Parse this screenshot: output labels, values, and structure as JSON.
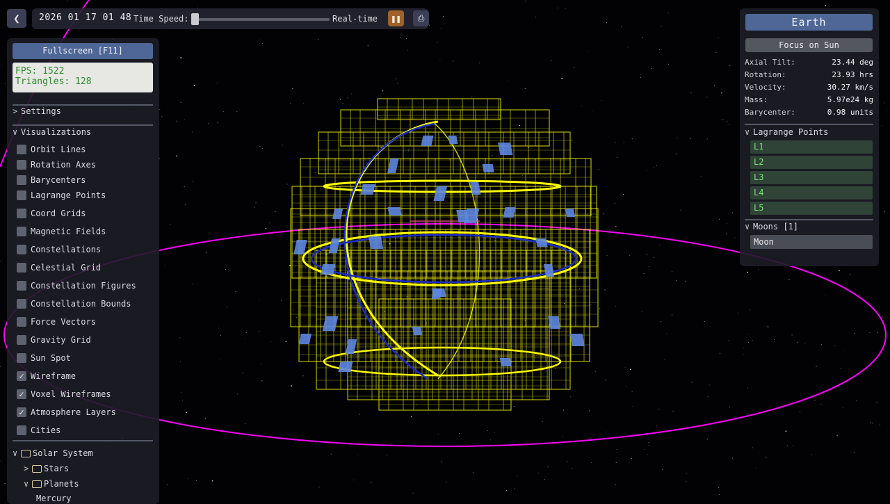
{
  "topbar": {
    "back_icon": "chevron-left-icon",
    "datetime": "2026 01 17 01 48",
    "time_speed_label": "Time Speed:",
    "time_speed_value": 0.0,
    "realtime_label": "Real-time",
    "pause_icon": "pause-icon",
    "pause_glyph": "❚❚",
    "screenshot_icon": "camera-icon",
    "screenshot_glyph": "⎙"
  },
  "left_panel": {
    "fullscreen_label": "Fullscreen [F11]",
    "fps_text": "FPS: 1522",
    "triangles_text": "Triangles: 128",
    "settings_label": "Settings",
    "visualizations_label": "Visualizations",
    "visualizations": [
      {
        "label": "Orbit Lines",
        "checked": false
      },
      {
        "label": "Rotation Axes",
        "checked": false
      },
      {
        "label": "Barycenters",
        "checked": false
      },
      {
        "label": "Lagrange Points",
        "checked": false
      },
      {
        "label": "Coord Grids",
        "checked": false
      },
      {
        "label": "Magnetic Fields",
        "checked": false
      },
      {
        "label": "Constellations",
        "checked": false
      },
      {
        "label": "Celestial Grid",
        "checked": false
      },
      {
        "label": "Constellation Figures",
        "checked": false
      },
      {
        "label": "Constellation Bounds",
        "checked": false
      },
      {
        "label": "Force Vectors",
        "checked": false
      },
      {
        "label": "Gravity Grid",
        "checked": false
      },
      {
        "label": "Sun Spot",
        "checked": false
      },
      {
        "label": "Wireframe",
        "checked": true
      },
      {
        "label": "Voxel Wireframes",
        "checked": true
      },
      {
        "label": "Atmosphere Layers",
        "checked": true
      },
      {
        "label": "Cities",
        "checked": false
      }
    ],
    "tree": {
      "solar_system": "Solar System",
      "stars": "Stars",
      "planets": "Planets",
      "mercury": "Mercury"
    }
  },
  "right_panel": {
    "body_name": "Earth",
    "focus_label": "Focus on Sun",
    "properties": [
      {
        "label": "Axial Tilt:",
        "value": "23.44 deg"
      },
      {
        "label": "Rotation:",
        "value": "23.93 hrs"
      },
      {
        "label": "Velocity:",
        "value": "30.27 km/s"
      },
      {
        "label": "Mass:",
        "value": "5.97e24 kg"
      },
      {
        "label": "Barycenter:",
        "value": "0.98 units"
      }
    ],
    "lagrange_header": "Lagrange Points",
    "lagrange_points": [
      "L1",
      "L2",
      "L3",
      "L4",
      "L5"
    ],
    "moons_header": "Moons [1]",
    "moons": [
      "Moon"
    ]
  },
  "colors": {
    "orbit": "#ff00ff",
    "voxel_wireframe": "#ffff00",
    "equator_ring": "#1a2ccc",
    "voxel_fill": "#5d86e0",
    "accent": "#4e6796",
    "lagrange_text": "#7ee07e"
  }
}
